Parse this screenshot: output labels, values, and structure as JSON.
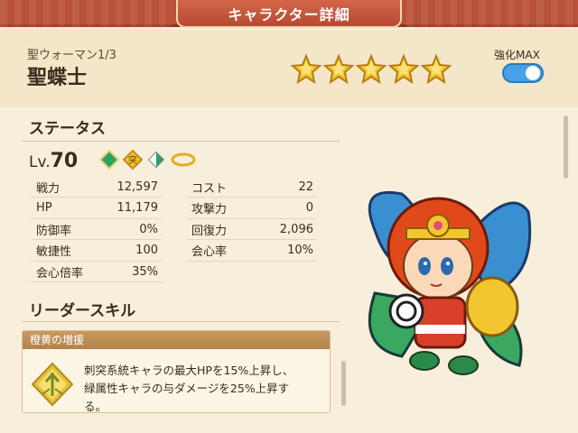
{
  "titlebar": {
    "title": "キャラクター詳細"
  },
  "header": {
    "subtitle": "聖ウォーマン1/3",
    "name": "聖蝶士",
    "rarity_stars": 5,
    "enhance_label": "強化MAX",
    "enhance_on": true
  },
  "status": {
    "heading": "ステータス",
    "level_prefix": "Lv.",
    "level": "70",
    "badge_icons": [
      "green-diamond-icon",
      "yellow-sword-icon",
      "white-green-diamond-icon",
      "gold-ring-icon"
    ],
    "badge_glyph": "突",
    "left": [
      {
        "label": "戦力",
        "value": "12,597"
      },
      {
        "label": "HP",
        "value": "11,179"
      },
      {
        "label": "防御率",
        "value": "0%"
      },
      {
        "label": "敏捷性",
        "value": "100"
      },
      {
        "label": "会心倍率",
        "value": "35%"
      }
    ],
    "right": [
      {
        "label": "コスト",
        "value": "22"
      },
      {
        "label": "攻撃力",
        "value": "0"
      },
      {
        "label": "回復力",
        "value": "2,096"
      },
      {
        "label": "会心率",
        "value": "10%"
      }
    ]
  },
  "leader": {
    "heading": "リーダースキル",
    "skill_name": "橙黄の増援",
    "text_line1": "刺突系統キャラの最大HPを15%上昇し、",
    "text_line2": "緑属性キャラの与ダメージを25%上昇す",
    "text_line3": "る。"
  },
  "colors": {
    "titlebar": "#b8523a",
    "background": "#f7eedb",
    "star": "#f4c531",
    "toggle": "#4aa0e6",
    "skill_header": "#b3834a"
  }
}
